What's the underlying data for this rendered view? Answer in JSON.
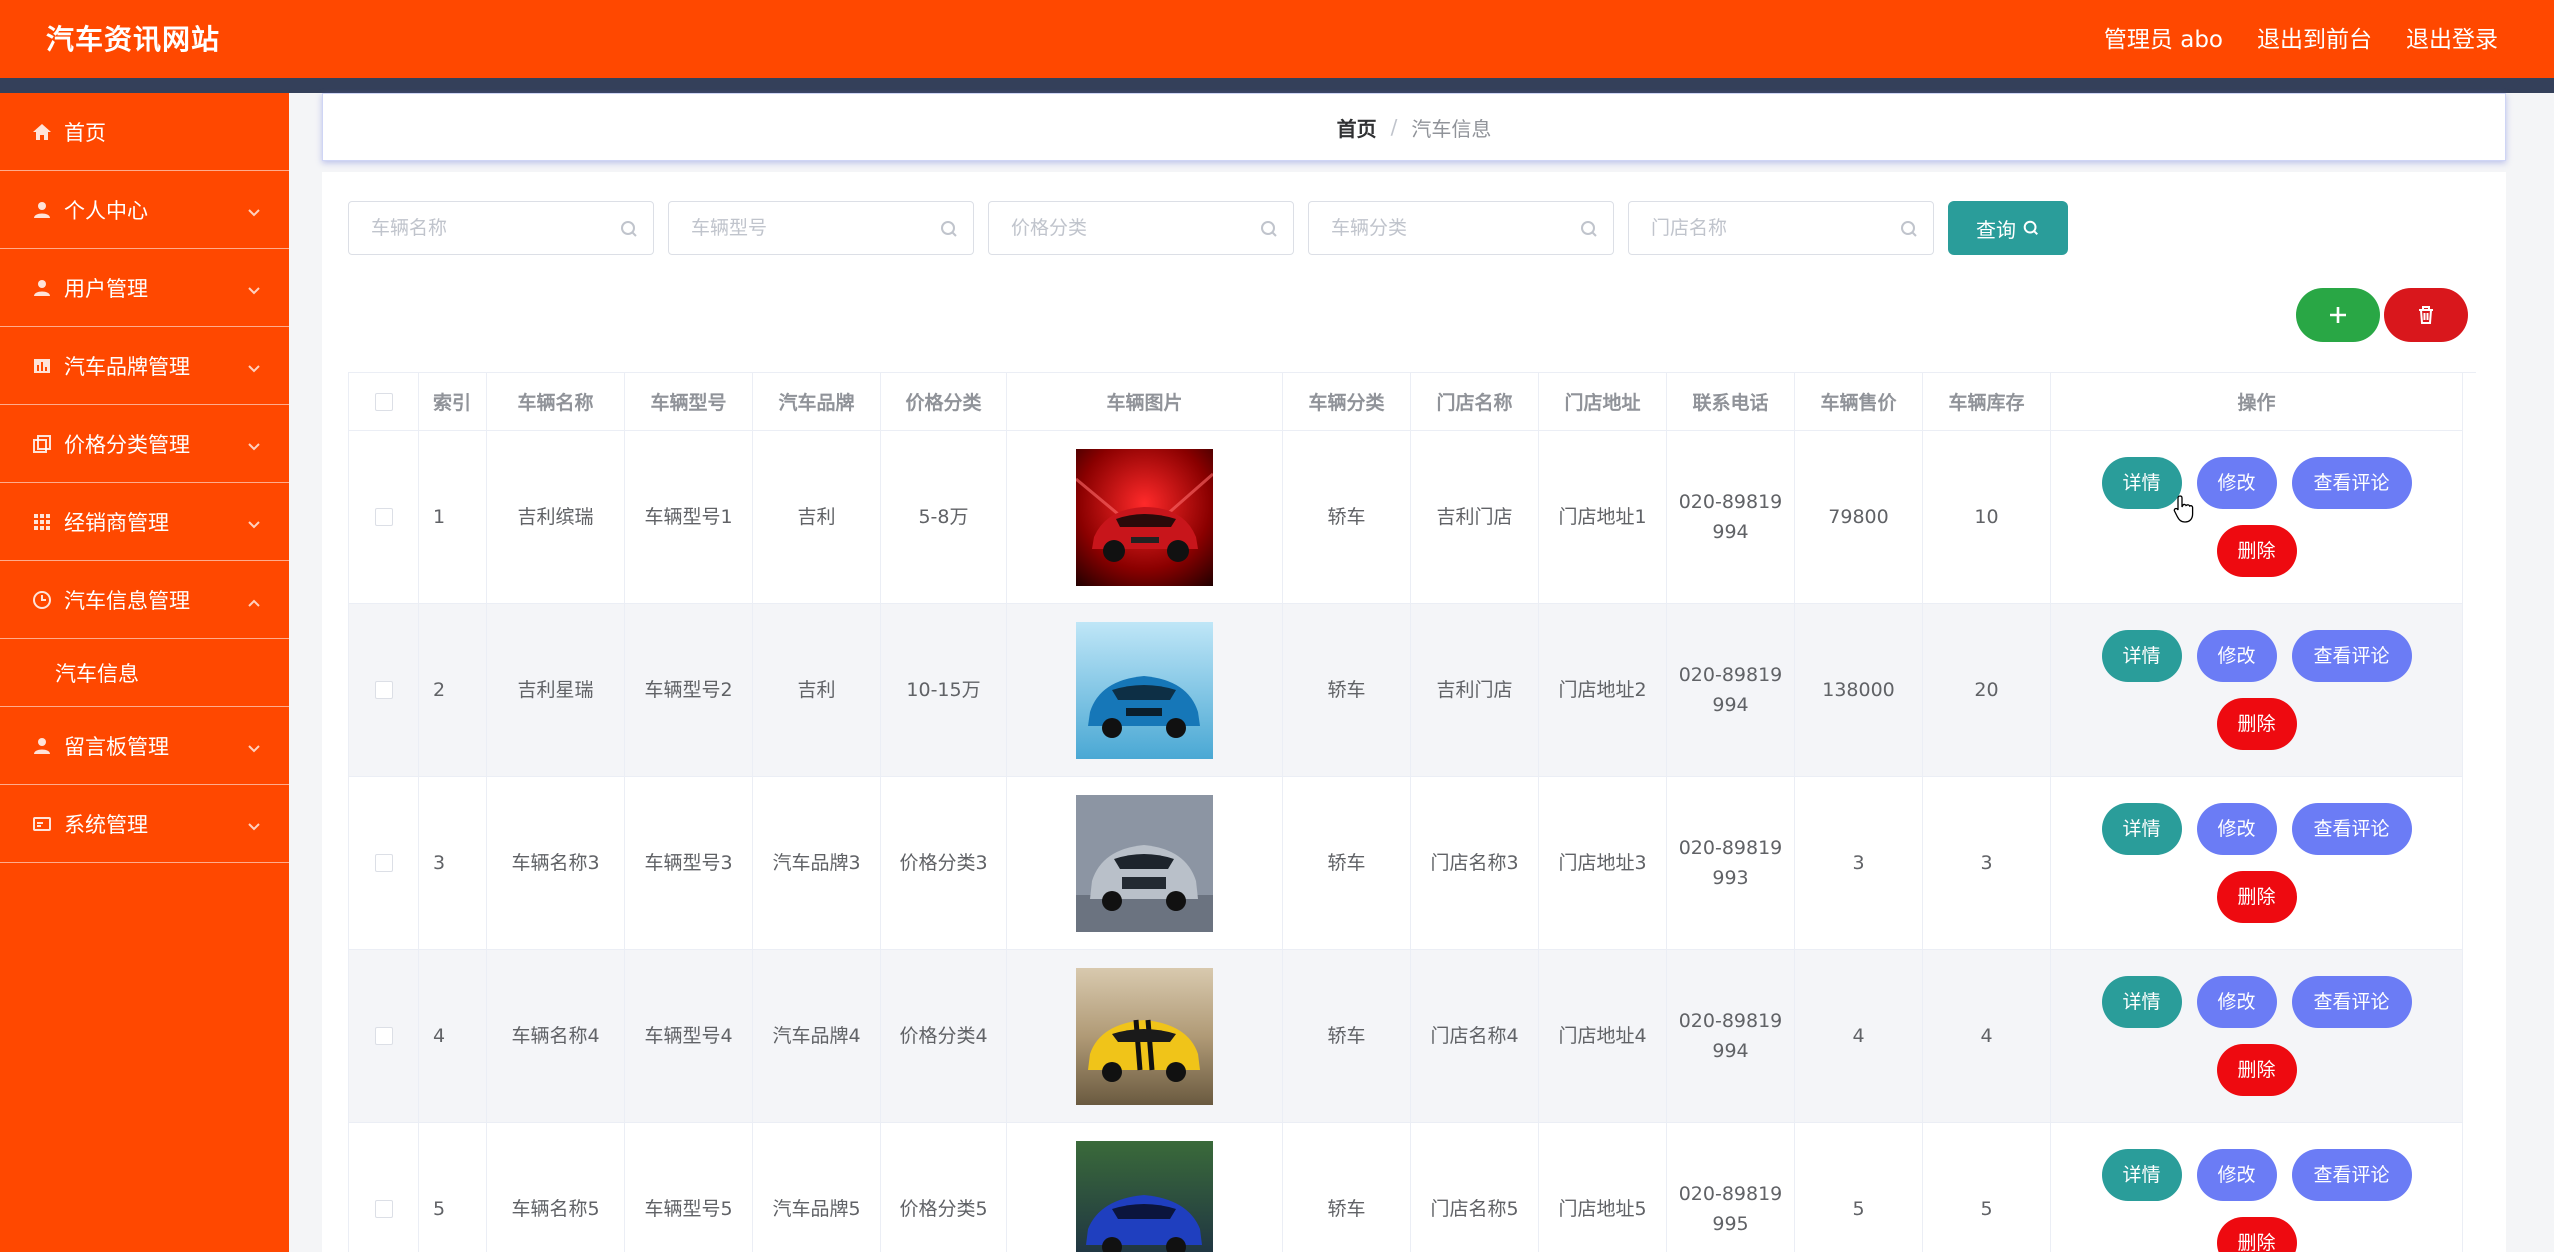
{
  "header": {
    "site_title": "汽车资讯网站",
    "admin_label": "管理员 abo",
    "to_frontend": "退出到前台",
    "logout": "退出登录"
  },
  "sidebar": {
    "items": [
      {
        "label": "首页",
        "icon": "home-icon"
      },
      {
        "label": "个人中心",
        "icon": "user-icon"
      },
      {
        "label": "用户管理",
        "icon": "user-icon"
      },
      {
        "label": "汽车品牌管理",
        "icon": "chart-icon"
      },
      {
        "label": "价格分类管理",
        "icon": "copy-icon"
      },
      {
        "label": "经销商管理",
        "icon": "grid-icon"
      },
      {
        "label": "汽车信息管理",
        "icon": "clock-icon"
      },
      {
        "label": "留言板管理",
        "icon": "user-icon"
      },
      {
        "label": "系统管理",
        "icon": "card-icon"
      }
    ],
    "submenu": {
      "label": "汽车信息"
    }
  },
  "breadcrumb": {
    "home": "首页",
    "sep": "/",
    "current": "汽车信息"
  },
  "search": {
    "vehicle_name": "车辆名称",
    "vehicle_model": "车辆型号",
    "price_category": "价格分类",
    "vehicle_category": "车辆分类",
    "store_name": "门店名称",
    "query_label": "查询"
  },
  "table": {
    "headers": {
      "index": "索引",
      "name": "车辆名称",
      "model": "车辆型号",
      "brand": "汽车品牌",
      "price_cat": "价格分类",
      "image": "车辆图片",
      "category": "车辆分类",
      "store": "门店名称",
      "address": "门店地址",
      "phone": "联系电话",
      "price": "车辆售价",
      "stock": "车辆库存",
      "ops": "操作"
    },
    "actions": {
      "detail": "详情",
      "edit": "修改",
      "review": "查看评论",
      "delete": "删除"
    },
    "rows": [
      {
        "index": "1",
        "name": "吉利缤瑞",
        "model": "车辆型号1",
        "brand": "吉利",
        "price_cat": "5-8万",
        "category": "轿车",
        "store": "吉利门店",
        "address": "门店地址1",
        "phone1": "020-89819",
        "phone2": "994",
        "price": "79800",
        "stock": "10"
      },
      {
        "index": "2",
        "name": "吉利星瑞",
        "model": "车辆型号2",
        "brand": "吉利",
        "price_cat": "10-15万",
        "category": "轿车",
        "store": "吉利门店",
        "address": "门店地址2",
        "phone1": "020-89819",
        "phone2": "994",
        "price": "138000",
        "stock": "20"
      },
      {
        "index": "3",
        "name": "车辆名称3",
        "model": "车辆型号3",
        "brand": "汽车品牌3",
        "price_cat": "价格分类3",
        "category": "轿车",
        "store": "门店名称3",
        "address": "门店地址3",
        "phone1": "020-89819",
        "phone2": "993",
        "price": "3",
        "stock": "3"
      },
      {
        "index": "4",
        "name": "车辆名称4",
        "model": "车辆型号4",
        "brand": "汽车品牌4",
        "price_cat": "价格分类4",
        "category": "轿车",
        "store": "门店名称4",
        "address": "门店地址4",
        "phone1": "020-89819",
        "phone2": "994",
        "price": "4",
        "stock": "4"
      },
      {
        "index": "5",
        "name": "车辆名称5",
        "model": "车辆型号5",
        "brand": "汽车品牌5",
        "price_cat": "价格分类5",
        "category": "轿车",
        "store": "门店名称5",
        "address": "门店地址5",
        "phone1": "020-89819",
        "phone2": "995",
        "price": "5",
        "stock": "5"
      }
    ]
  },
  "colors": {
    "primary": "#ff4800",
    "strip": "#34405a",
    "teal": "#2a9d9a",
    "violet": "#6b7cf5",
    "red": "#ee0a10",
    "green": "#29a745"
  }
}
